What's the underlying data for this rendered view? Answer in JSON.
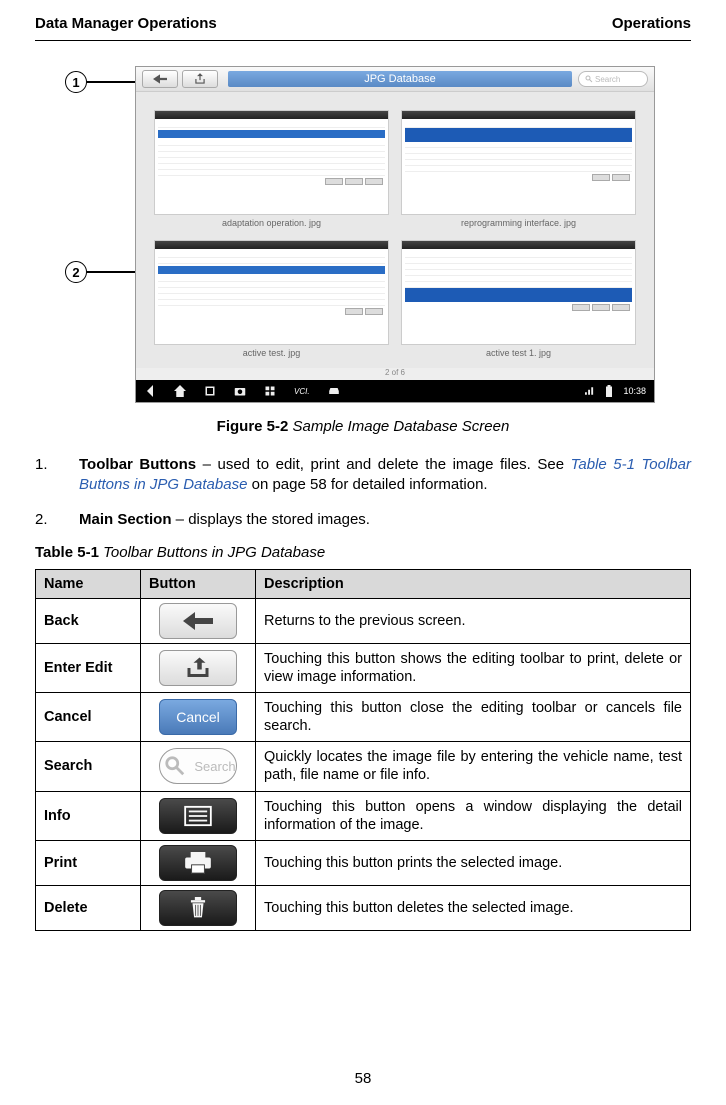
{
  "header": {
    "left": "Data Manager Operations",
    "right": "Operations"
  },
  "callouts": {
    "one": "1",
    "two": "2"
  },
  "screenshot": {
    "title": "JPG Database",
    "search_placeholder": "Search",
    "tiles": [
      {
        "caption": "adaptation operation. jpg"
      },
      {
        "caption": "reprogramming interface. jpg"
      },
      {
        "caption": "active test. jpg"
      },
      {
        "caption": "active test 1. jpg"
      }
    ],
    "pager": "2 of 6",
    "clock": "10:38"
  },
  "figure": {
    "label": "Figure 5-2",
    "caption": "Sample Image Database Screen"
  },
  "items": [
    {
      "num": "1.",
      "bold": "Toolbar Buttons",
      "text_a": " – used to edit, print and delete the image files. See ",
      "ref": "Table 5-1 Toolbar Buttons in JPG Database",
      "text_b": " on page 58 for detailed information."
    },
    {
      "num": "2.",
      "bold": "Main Section",
      "text_a": " – displays the stored images.",
      "ref": "",
      "text_b": ""
    }
  ],
  "table": {
    "label": "Table 5-1",
    "caption": "Toolbar Buttons in JPG Database",
    "headers": {
      "name": "Name",
      "button": "Button",
      "desc": "Description"
    },
    "rows": [
      {
        "name": "Back",
        "btn_label": "",
        "desc": "Returns to the previous screen."
      },
      {
        "name": "Enter Edit",
        "btn_label": "",
        "desc": "Touching this button shows the editing toolbar to print, delete or view image information."
      },
      {
        "name": "Cancel",
        "btn_label": "Cancel",
        "desc": "Touching this button close the editing toolbar or cancels file search."
      },
      {
        "name": "Search",
        "btn_label": "Search",
        "desc": "Quickly locates the image file by entering the vehicle name, test path, file name or file info."
      },
      {
        "name": "Info",
        "btn_label": "",
        "desc": "Touching this button opens a window displaying the detail information of the image."
      },
      {
        "name": "Print",
        "btn_label": "",
        "desc": "Touching this button prints the selected image."
      },
      {
        "name": "Delete",
        "btn_label": "",
        "desc": "Touching this button deletes the selected image."
      }
    ]
  },
  "page_number": "58"
}
